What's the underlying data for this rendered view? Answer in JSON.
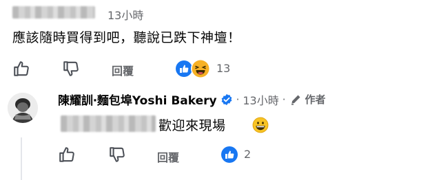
{
  "top_comment": {
    "timestamp": "13小時",
    "text": "應該隨時買得到吧，聽說已跌下神壇！",
    "reply_label": "回覆",
    "reaction_count": "13",
    "reactions": [
      "like-icon",
      "haha-icon"
    ]
  },
  "reply": {
    "author": "陳耀訓‧麵包埠Yoshi Bakery",
    "verified": "verified-badge-icon",
    "separator": "·",
    "timestamp": "13小時",
    "separator2": "·",
    "author_badge": "作者",
    "text": "歡迎來現場",
    "reply_label": "回覆",
    "reaction_count": "2",
    "reactions": [
      "like-icon"
    ]
  },
  "colors": {
    "meta": "#65676b",
    "text": "#050505",
    "blue": "#1877f2",
    "haha": "#f7b125"
  }
}
